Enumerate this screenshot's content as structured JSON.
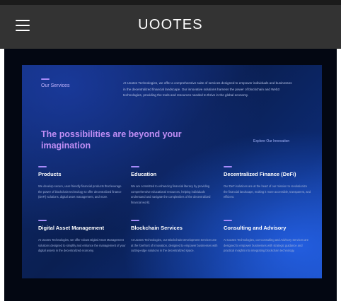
{
  "navbar": {
    "brand": "UOOTES",
    "menu_icon": "hamburger-menu-icon"
  },
  "services": {
    "section_label": "Our Services",
    "intro": "At Uootes Technologies, we offer a comprehensive suite of services designed to empower individuals and businesses in the decentralized financial landscape. Our innovative solutions harness the power of blockchain and Web3 technologies, providing the tools and resources needed to thrive in the global economy.",
    "headline": "The possibilities are beyond your imagination",
    "explore_link": "Explore Our Innovation",
    "items": [
      {
        "title": "Products",
        "desc": "We develop secure, user-friendly financial products that leverage the power of blockchain technology to offer decentralized finance (DeFi) solutions, digital asset management, and more."
      },
      {
        "title": "Education",
        "desc": "We are committed to enhancing financial literacy by providing comprehensive educational resources, helping individuals understand and navigate the complexities of the decentralized financial world."
      },
      {
        "title": "Decentralized Finance (DeFi)",
        "desc": "Our DeFi solutions are at the heart of our mission to revolutionize the financial landscape, making it more accessible, transparent, and efficient."
      },
      {
        "title": "Digital Asset Management",
        "desc": "At Uootes Technologies, we offer robust Digital Asset Management solutions designed to simplify and enhance the management of your digital assets in the decentralized economy."
      },
      {
        "title": "Blockchain Services",
        "desc": "At Uootes Technologies, our Blockchain Development Services are at the forefront of innovation, designed to empower businesses with cutting-edge solutions in the decentralized space."
      },
      {
        "title": "Consulting and Advisory",
        "desc": "At Uootes Technologies, our Consulting and Advisory Services are designed to empower businesses with strategic guidance and practical insights into integrating blockchain technology."
      }
    ]
  },
  "colors": {
    "navbar_bg": "#333333",
    "accent": "#a78bfa",
    "card_bg": "#0a1f52",
    "headline": "#c08ef5"
  }
}
